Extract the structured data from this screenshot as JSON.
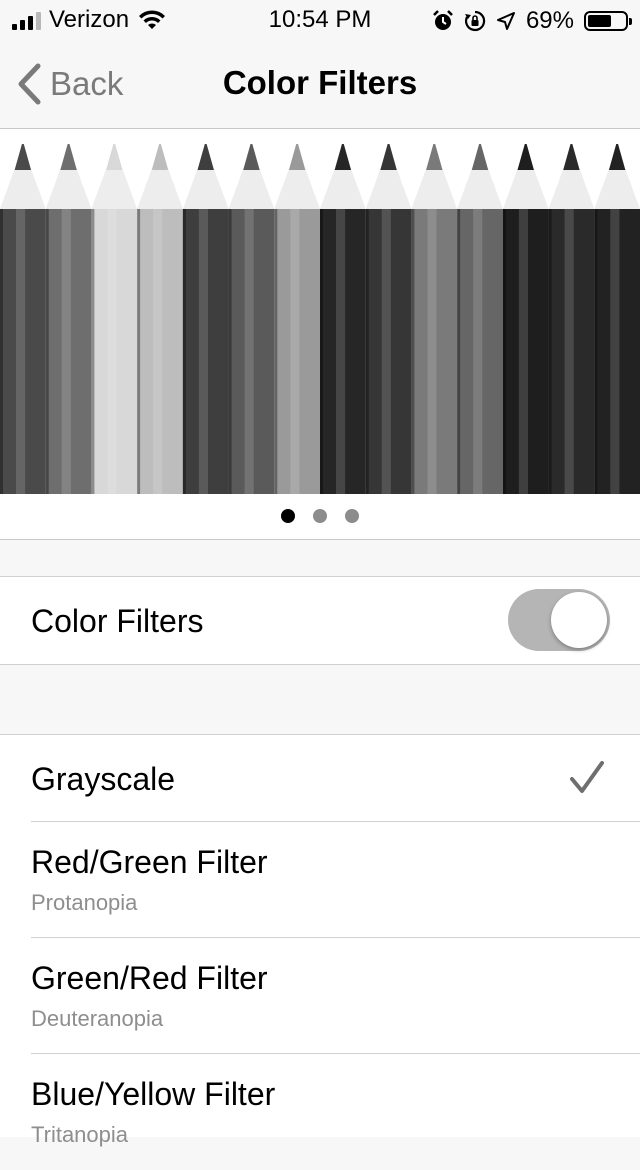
{
  "status_bar": {
    "carrier": "Verizon",
    "time": "10:54 PM",
    "battery_percent": "69%",
    "battery_level": 0.69,
    "icons": [
      "signal-icon",
      "wifi-icon",
      "alarm-icon",
      "rotation-lock-icon",
      "location-icon",
      "battery-icon"
    ]
  },
  "nav": {
    "back_label": "Back",
    "title": "Color Filters"
  },
  "carousel": {
    "pencil_shades": [
      "#4a4a4a",
      "#6e6e6e",
      "#d8d8d8",
      "#bdbdbd",
      "#3e3e3e",
      "#5a5a5a",
      "#9a9a9a",
      "#262626",
      "#363636",
      "#7a7a7a",
      "#666666",
      "#1e1e1e",
      "#2a2a2a",
      "#222222"
    ],
    "pages": 3,
    "active_page": 1
  },
  "color_filters_toggle": {
    "label": "Color Filters",
    "on": true
  },
  "filters": [
    {
      "title": "Grayscale",
      "subtitle": "",
      "selected": true
    },
    {
      "title": "Red/Green Filter",
      "subtitle": "Protanopia",
      "selected": false
    },
    {
      "title": "Green/Red Filter",
      "subtitle": "Deuteranopia",
      "selected": false
    },
    {
      "title": "Blue/Yellow Filter",
      "subtitle": "Tritanopia",
      "selected": false
    }
  ]
}
